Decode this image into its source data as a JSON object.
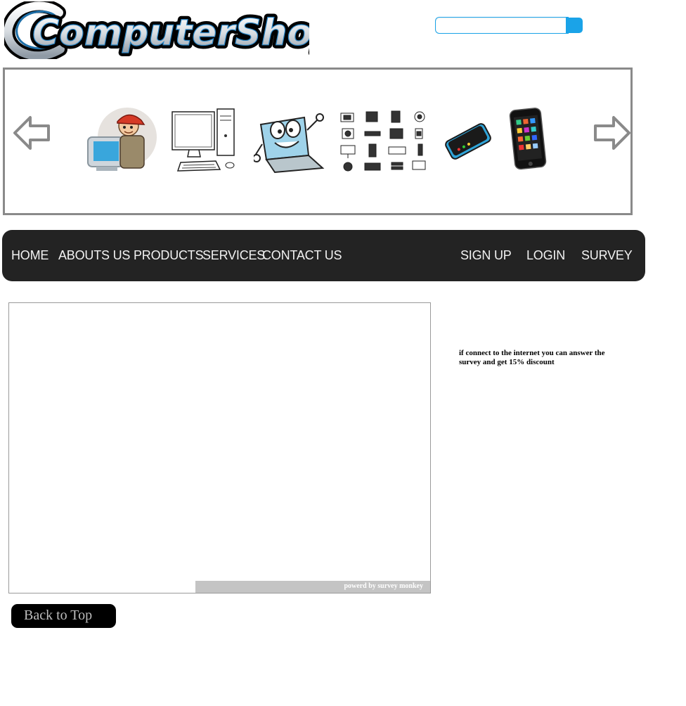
{
  "header": {
    "logo_text": "ComputerShop"
  },
  "search": {
    "placeholder": "",
    "value": "",
    "accent_color": "#1aa3e8"
  },
  "slider": {
    "prev_icon": "arrow-left-icon",
    "next_icon": "arrow-right-icon",
    "slides": [
      {
        "icon": "technician-icon"
      },
      {
        "icon": "desktop-computer-icon"
      },
      {
        "icon": "laptop-cartoon-icon"
      },
      {
        "icon": "hardware-grid-icon"
      },
      {
        "icon": "mobile-phone-icon"
      },
      {
        "icon": "smartphone-icon"
      }
    ]
  },
  "nav": {
    "left": [
      {
        "label": "HOME"
      },
      {
        "label": "ABOUTS US"
      },
      {
        "label": "PRODUCTS"
      },
      {
        "label": "SERVICES"
      },
      {
        "label": "CONTACT US"
      }
    ],
    "right": [
      {
        "label": "SIGN UP"
      },
      {
        "label": "LOGIN"
      },
      {
        "label": "SURVEY"
      }
    ],
    "bg_color": "#232323"
  },
  "survey": {
    "powered_by": "powerd by survey monkey"
  },
  "notice": {
    "text": "if connect to the internet you can answer the survey and get 15% discount"
  },
  "back_to_top": {
    "label": "Back to Top"
  }
}
